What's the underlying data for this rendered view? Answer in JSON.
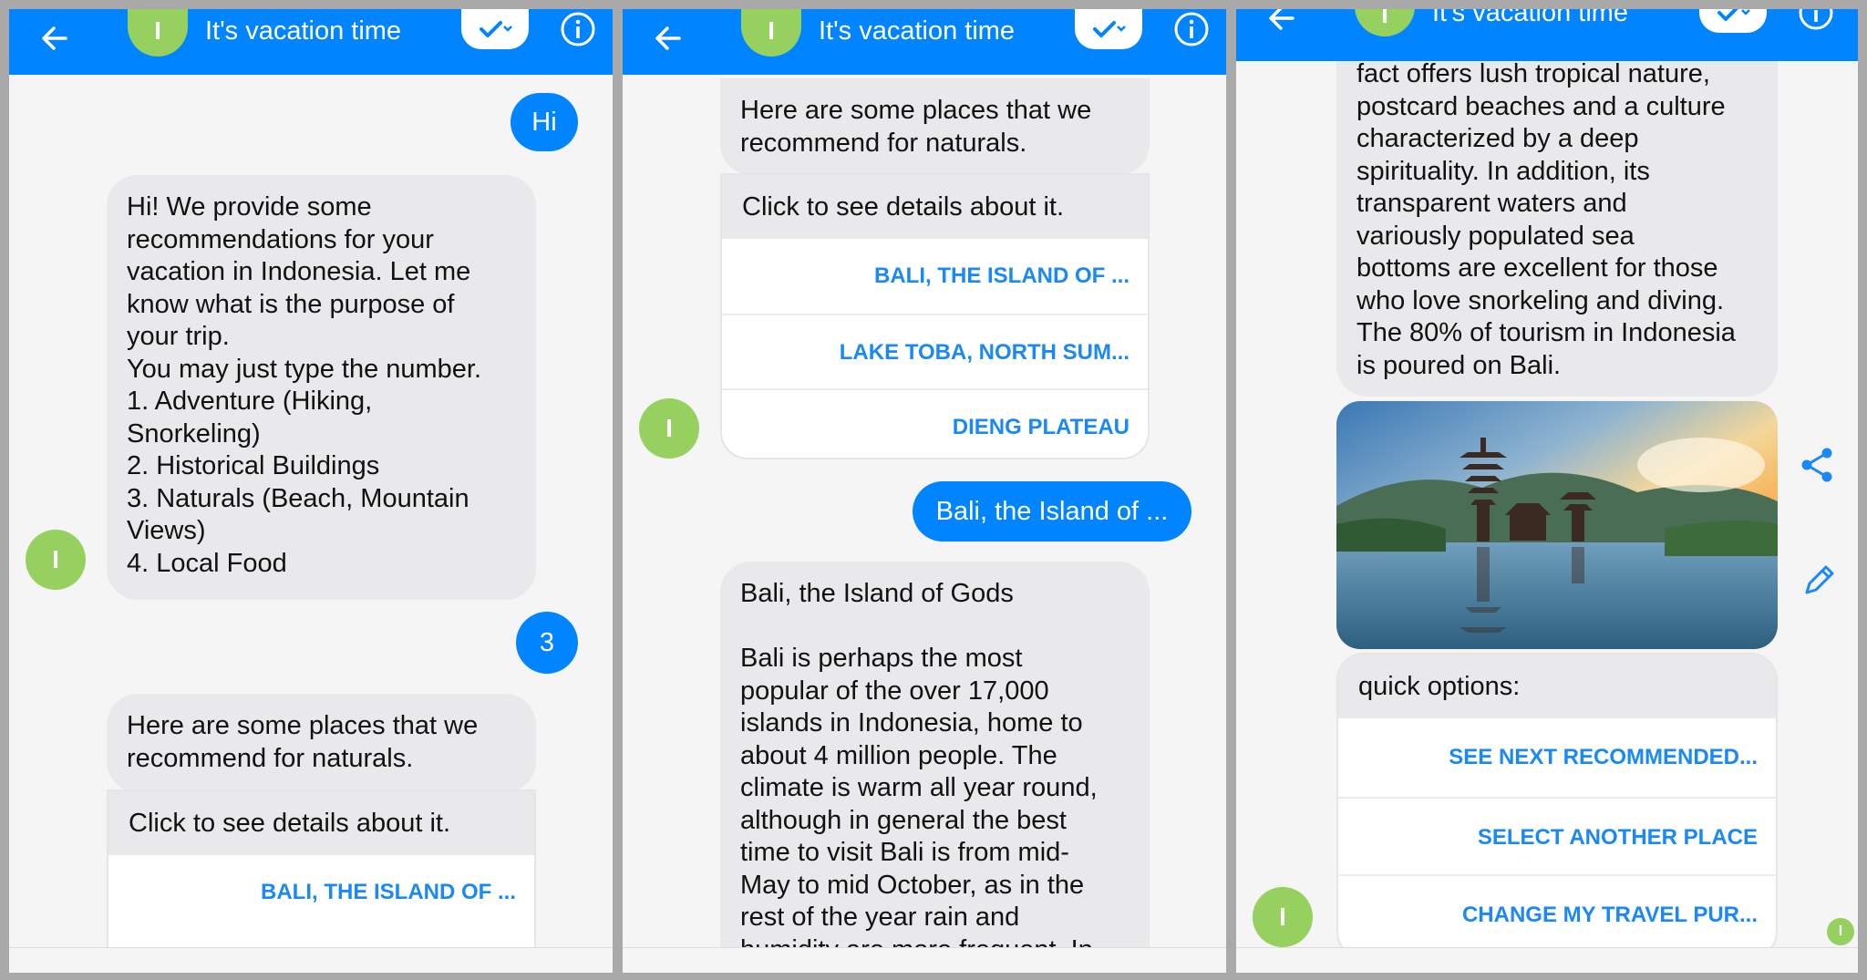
{
  "header": {
    "title": "It's vacation time",
    "avatar_initial": "I"
  },
  "panel1": {
    "user_hi": "Hi",
    "bot_intro": [
      "Hi! We provide some",
      "recommendations for your",
      "vacation in Indonesia. Let me",
      "know what is the purpose of",
      "your trip.",
      "You may just type the number.",
      "1. Adventure (Hiking,",
      "Snorkeling)",
      "2. Historical Buildings",
      "3. Naturals (Beach, Mountain",
      "Views)",
      "4. Local Food"
    ],
    "user_choice": "3",
    "bot_places": [
      "Here are some places that we",
      "recommend for naturals."
    ],
    "card_header": "Click to see details about it.",
    "card_items": [
      "BALI, THE ISLAND OF ..."
    ]
  },
  "panel2": {
    "bot_places": [
      "Here are some places that we",
      "recommend for naturals."
    ],
    "card_header": "Click to see details about it.",
    "card_items": [
      "BALI, THE ISLAND OF ...",
      "LAKE TOBA, NORTH SUM...",
      "DIENG PLATEAU"
    ],
    "user_selection": "Bali, the Island of ...",
    "bali_text": [
      "Bali, the Island of Gods",
      "",
      "Bali is perhaps the most",
      "popular of the over 17,000",
      "islands in Indonesia, home to",
      "about 4 million people. The",
      "climate is warm all year round,",
      "although in general the best",
      "time to visit Bali is from mid-",
      "May to mid October, as in the",
      "rest of the year rain and",
      "humidity are more frequent. In"
    ]
  },
  "panel3": {
    "bali_text": [
      "fact offers lush tropical nature,",
      "postcard beaches and a culture",
      "characterized by a deep",
      "spirituality. In addition, its",
      "transparent waters and",
      "variously populated sea",
      "bottoms are excellent for those",
      "who love snorkeling and diving.",
      "The 80% of tourism in Indonesia",
      "is poured on Bali."
    ],
    "quick_header": "quick options:",
    "quick_items": [
      "SEE NEXT RECOMMENDED...",
      "SELECT ANOTHER PLACE",
      "CHANGE MY TRAVEL PUR..."
    ]
  },
  "icons": [
    "back-arrow-icon",
    "checkmark-dropdown-icon",
    "info-icon",
    "share-icon",
    "edit-pencil-icon"
  ],
  "colors": {
    "messenger_blue": "#0084ff",
    "bot_bubble": "#e9e9eb",
    "avatar_green": "#96d160",
    "link_blue": "#1a88f5"
  }
}
